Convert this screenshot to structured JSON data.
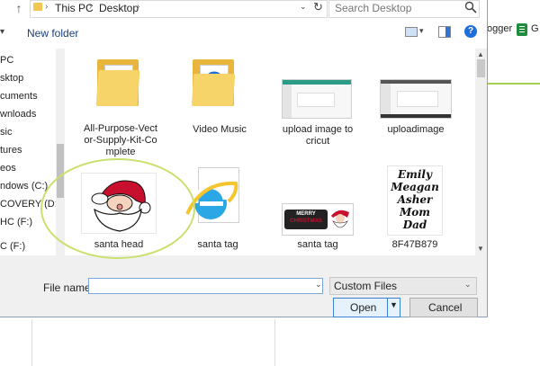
{
  "address_bar": {
    "path": [
      "This PC",
      "Desktop"
    ],
    "separator": "›"
  },
  "search": {
    "placeholder": "Search Desktop"
  },
  "toolbar": {
    "new_folder_label": "New folder",
    "help_glyph": "?"
  },
  "nav_pane": {
    "items": [
      {
        "label": "PC"
      },
      {
        "label": "sktop"
      },
      {
        "label": "cuments"
      },
      {
        "label": "wnloads"
      },
      {
        "label": "sic"
      },
      {
        "label": "tures"
      },
      {
        "label": "eos"
      },
      {
        "label": "ndows (C:)"
      },
      {
        "label": "COVERY (D:)"
      },
      {
        "label": "HC (F:)"
      },
      {
        "label": "C (F:)"
      }
    ]
  },
  "files": [
    {
      "name": "All-Purpose-Vect\nor-Supply-Kit-Co\nmplete",
      "kind": "folder"
    },
    {
      "name": "Video Music",
      "kind": "folder"
    },
    {
      "name": "upload image to\ncricut",
      "kind": "image"
    },
    {
      "name": "uploadimage",
      "kind": "image"
    },
    {
      "name": "santa head",
      "kind": "image"
    },
    {
      "name": "santa tag",
      "kind": "ie-file"
    },
    {
      "name": "santa tag",
      "kind": "image"
    },
    {
      "name": "8F47B879",
      "kind": "image"
    }
  ],
  "thumb_text": {
    "merry_christmas": [
      "MERRY",
      "CHRISTMAS"
    ],
    "family_names": [
      "Emily",
      "Meagan",
      "Asher",
      "Mom",
      "Dad"
    ]
  },
  "footer": {
    "file_name_label": "File name:",
    "file_name_value": "",
    "file_type_selected": "Custom Files",
    "open_label": "Open",
    "cancel_label": "Cancel"
  },
  "background_app": {
    "blogger_label": "ogger",
    "sheets_label": "G"
  },
  "colors": {
    "folder": "#f7d46a",
    "highlight_circle": "#c9e06d",
    "accent_blue": "#1e6fd9",
    "sheets_green": "#1e8e3e"
  }
}
